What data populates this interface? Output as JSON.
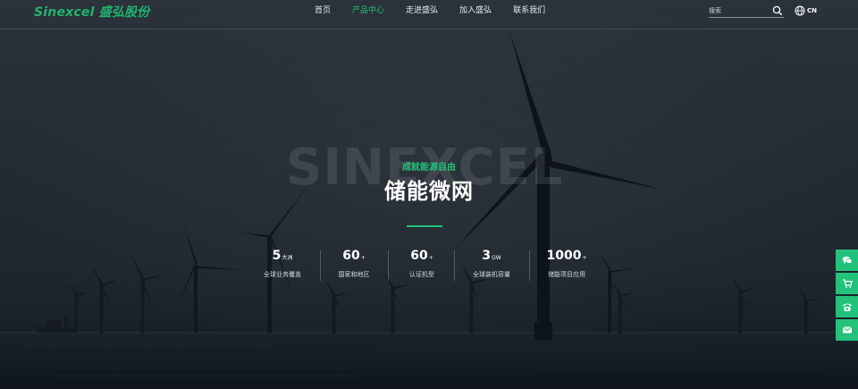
{
  "header": {
    "logo_text": "Sinexcel 盛弘股份",
    "nav": [
      {
        "label": "首页",
        "active": false
      },
      {
        "label": "产品中心",
        "active": true
      },
      {
        "label": "走进盛弘",
        "active": false
      },
      {
        "label": "加入盛弘",
        "active": false
      },
      {
        "label": "联系我们",
        "active": false
      }
    ],
    "search": {
      "placeholder": "搜索",
      "icon": "search-icon"
    },
    "language": {
      "label": "CN",
      "icon": "globe-icon"
    }
  },
  "hero": {
    "watermark": "SINEXCEL",
    "slogan": "成就能源自由",
    "title": "储能微网",
    "accent_color": "#22c27a",
    "stats": [
      {
        "value": "5",
        "unit": "大洲",
        "label": "全球业务覆盖"
      },
      {
        "value": "60",
        "unit": "+",
        "label": "国家和地区"
      },
      {
        "value": "60",
        "unit": "+",
        "label": "认证机型"
      },
      {
        "value": "3",
        "unit": "GW",
        "label": "全球装机容量"
      },
      {
        "value": "1000",
        "unit": "+",
        "label": "储能项目应用"
      }
    ]
  },
  "side_bar": {
    "buttons": [
      {
        "icon": "chat-icon"
      },
      {
        "icon": "cart-icon"
      },
      {
        "icon": "phone-icon"
      },
      {
        "icon": "mail-icon"
      }
    ]
  }
}
